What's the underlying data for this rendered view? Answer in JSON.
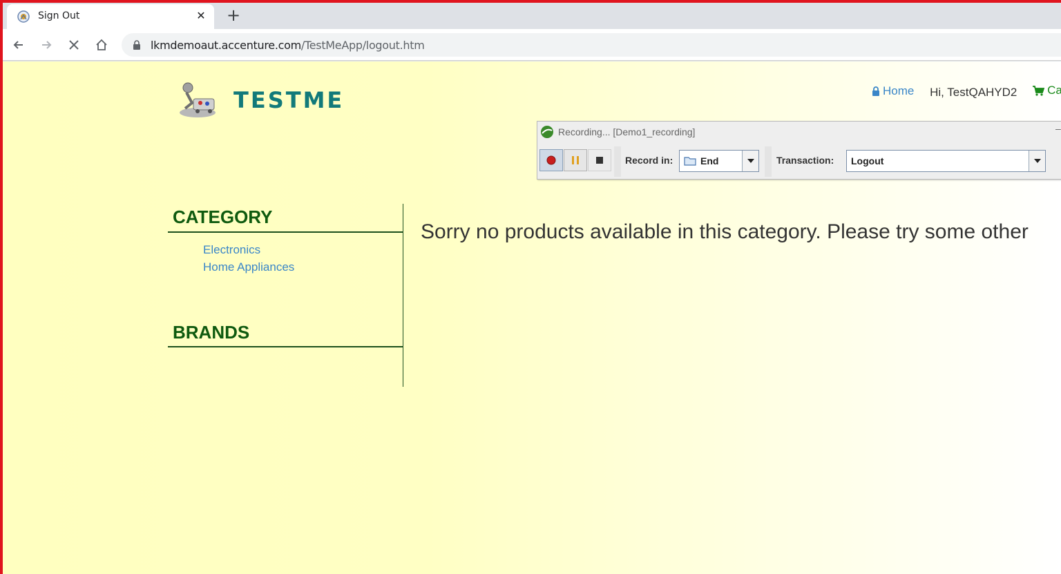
{
  "browser": {
    "tab_title": "Sign Out",
    "new_tab_symbol": "+",
    "tab_close_symbol": "✕",
    "url_host": "lkmdemoaut.accenture.com",
    "url_path": "/TestMeApp/logout.htm",
    "icons": [
      "back-icon",
      "forward-icon",
      "stop-icon",
      "home-icon",
      "lock-icon"
    ]
  },
  "header": {
    "brand": "TESTME",
    "nav_home": "Home",
    "nav_greeting": "Hi, TestQAHYD2",
    "nav_cart": "Ca"
  },
  "sidebar": {
    "category_title": "CATEGORY",
    "categories": [
      "Electronics",
      "Home Appliances"
    ],
    "brands_title": "BRANDS"
  },
  "main": {
    "message": "Sorry no products available in this category. Please try some other"
  },
  "recorder": {
    "title": "Recording... [Demo1_recording]",
    "record_in_label": "Record in:",
    "record_in_value": "End",
    "transaction_label": "Transaction:",
    "transaction_value": "Logout",
    "minimize_symbol": "–"
  },
  "colors": {
    "frame": "#e0141e",
    "brand": "#127a7a",
    "section_title": "#0f5a0f",
    "link": "#3a86c8",
    "cart": "#1a8a1a"
  }
}
